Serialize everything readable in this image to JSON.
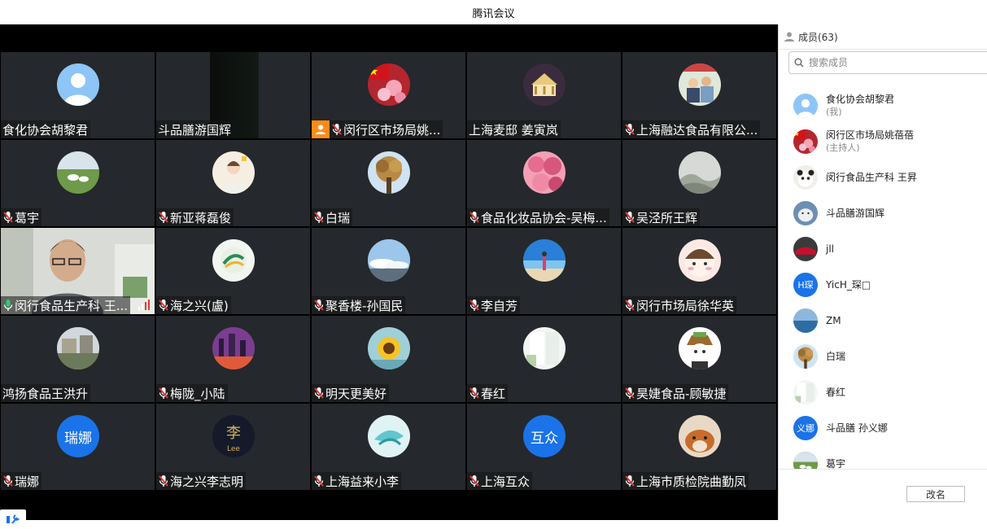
{
  "window": {
    "title": "腾讯会议"
  },
  "colors": {
    "host_badge": "#ff8c1a",
    "speaking_border": "#2ecc71",
    "muted_mic": "#e53935",
    "text_avatar": "#1a73e8"
  },
  "participants_panel": {
    "title": "成员(63)",
    "search_placeholder": "搜索成员",
    "rename_label": "改名",
    "members": [
      {
        "name": "食化协会胡黎君",
        "tag": "(我)"
      },
      {
        "name": "闵行区市场局姚蓓蓓",
        "tag": "(主持人)"
      },
      {
        "name": "闵行食品生产科 王昇",
        "tag": ""
      },
      {
        "name": "斗品膳游国辉",
        "tag": ""
      },
      {
        "name": "jll",
        "tag": ""
      },
      {
        "name": "YicH_琛□",
        "tag": "",
        "avatar_text": "H琛"
      },
      {
        "name": "ZM",
        "tag": ""
      },
      {
        "name": "白瑞",
        "tag": ""
      },
      {
        "name": "春红",
        "tag": ""
      },
      {
        "name": "斗品膳 孙义娜",
        "tag": "",
        "avatar_text": "义娜"
      },
      {
        "name": "葛宇",
        "tag": ""
      }
    ]
  },
  "tiles": [
    {
      "name": "食化协会胡黎君",
      "mic": "none",
      "avatar": "default-person"
    },
    {
      "name": "斗品膳游国辉",
      "mic": "none",
      "avatar": "dark-video"
    },
    {
      "name": "闵行区市场局姚...",
      "mic": "muted",
      "avatar": "flag-blossom",
      "host": true
    },
    {
      "name": "上海麦邸 姜寅岚",
      "mic": "none",
      "avatar": "carousel"
    },
    {
      "name": "上海融达食品有限公...",
      "mic": "muted",
      "avatar": "family-photo"
    },
    {
      "name": "葛宇",
      "mic": "muted",
      "avatar": "sheep-field"
    },
    {
      "name": "新亚蒋磊俊",
      "mic": "muted",
      "avatar": "girl-photo"
    },
    {
      "name": "白瑞",
      "mic": "muted",
      "avatar": "tree"
    },
    {
      "name": "食品化妆品协会-吴梅...",
      "mic": "muted",
      "avatar": "roses"
    },
    {
      "name": "吴泾所王辉",
      "mic": "muted",
      "avatar": "foggy-hills"
    },
    {
      "name": "闵行食品生产科 王...",
      "mic": "active",
      "avatar": "camera-person",
      "speaking": true
    },
    {
      "name": "海之兴(盧)",
      "mic": "muted",
      "avatar": "logo-green"
    },
    {
      "name": "聚香楼-孙国民",
      "mic": "muted",
      "avatar": "sky-clouds"
    },
    {
      "name": "李自芳",
      "mic": "muted",
      "avatar": "beach"
    },
    {
      "name": "闵行市场局徐华英",
      "mic": "muted",
      "avatar": "cartoon-face"
    },
    {
      "name": "鸿扬食品王洪升",
      "mic": "none",
      "avatar": "street"
    },
    {
      "name": "梅陇_小陆",
      "mic": "muted",
      "avatar": "city-night"
    },
    {
      "name": "明天更美好",
      "mic": "muted",
      "avatar": "sunflower"
    },
    {
      "name": "春红",
      "mic": "muted",
      "avatar": "white-room"
    },
    {
      "name": "昊婕食品-顾敏捷",
      "mic": "muted",
      "avatar": "cartoon-hat"
    },
    {
      "name": "瑞娜",
      "mic": "muted",
      "avatar": "text",
      "avatar_text": "瑞娜"
    },
    {
      "name": "海之兴李志明",
      "mic": "muted",
      "avatar": "lee-logo",
      "avatar_text": "李",
      "avatar_subtext": "Lee"
    },
    {
      "name": "上海益来小李",
      "mic": "muted",
      "avatar": "teal-art"
    },
    {
      "name": "上海互众",
      "mic": "muted",
      "avatar": "text",
      "avatar_text": "互众"
    },
    {
      "name": "上海市质检院曲勤凤",
      "mic": "muted",
      "avatar": "dog"
    }
  ]
}
